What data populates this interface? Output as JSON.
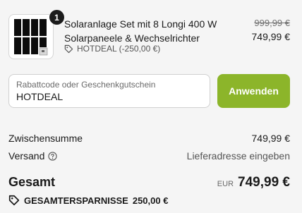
{
  "product": {
    "quantity": "1",
    "title": "Solaranlage Set mit 8 Longi 400 W Solarpaneele & Wechselrichter",
    "discount_label": "HOTDEAL (-250,00 €)",
    "price_original": "999,99 €",
    "price_current": "749,99 €",
    "image_icon": "solar-panel-icon"
  },
  "discount_code": {
    "label": "Rabattcode oder Geschenkgutschein",
    "value": "HOTDEAL",
    "apply_label": "Anwenden",
    "accent_color": "#8cb52a"
  },
  "summary": {
    "subtotal_label": "Zwischensumme",
    "subtotal_value": "749,99 €",
    "shipping_label": "Versand",
    "shipping_value": "Lieferadresse eingeben"
  },
  "total": {
    "label": "Gesamt",
    "currency": "EUR",
    "amount": "749,99 €",
    "savings_label": "GESAMTERSPARNISSE",
    "savings_value": "250,00 €"
  }
}
